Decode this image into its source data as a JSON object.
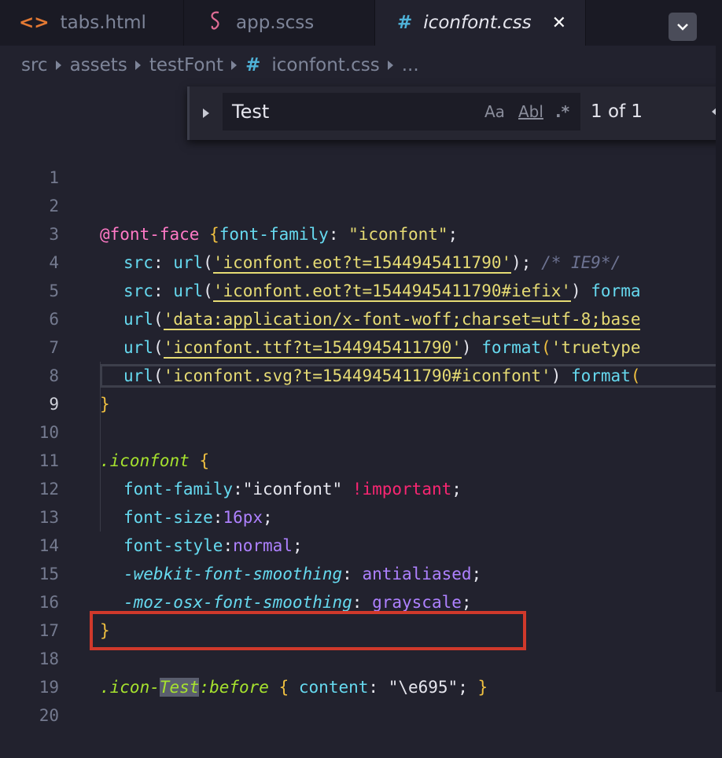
{
  "tabs": [
    {
      "icon": "<>",
      "label": "tabs.html"
    },
    {
      "icon": "sass",
      "label": "app.scss"
    },
    {
      "icon": "#",
      "label": "iconfont.css",
      "active": true
    }
  ],
  "breadcrumb": [
    "src",
    "assets",
    "testFont",
    "iconfont.css",
    "..."
  ],
  "find": {
    "query": "Test",
    "match_case": "Aa",
    "whole_word": "Abl",
    "regex": ".*",
    "count": "1 of 1"
  },
  "lines": [
    "1",
    "2",
    "3",
    "4",
    "5",
    "6",
    "7",
    "8",
    "9",
    "10",
    "11",
    "12",
    "13",
    "14",
    "15",
    "16",
    "17",
    "18",
    "19",
    "20"
  ],
  "code": {
    "l2": [
      "@font-face",
      " {",
      "font-family",
      ": ",
      "\"iconfont\"",
      ";"
    ],
    "l3": [
      "src",
      ": ",
      "url",
      "(",
      "'iconfont.eot?t=1544945411790'",
      ");",
      " /* IE9*/"
    ],
    "l4": [
      "src",
      ": ",
      "url",
      "(",
      "'iconfont.eot?t=1544945411790#iefix'",
      ") ",
      "forma"
    ],
    "l5": [
      "url",
      "(",
      "'data:application/x-font-woff;charset=utf-8;base"
    ],
    "l6": [
      "url",
      "(",
      "'iconfont.ttf?t=1544945411790'",
      ") ",
      "format",
      "(",
      "'truetype"
    ],
    "l7": [
      "url",
      "(",
      "'iconfont.svg?t=1544945411790#iconfont'",
      ") ",
      "format",
      "("
    ],
    "l8": [
      "}"
    ],
    "l10": [
      ".iconfont",
      " {"
    ],
    "l11": [
      "font-family",
      ":",
      "\"iconfont\"",
      " !important",
      ";"
    ],
    "l12": [
      "font-size",
      ":",
      "16px",
      ";"
    ],
    "l13": [
      "font-style",
      ":",
      "normal",
      ";"
    ],
    "l14": [
      "-webkit-font-smoothing",
      ": ",
      "antialiased",
      ";"
    ],
    "l15": [
      "-moz-osx-font-smoothing",
      ": ",
      "grayscale",
      ";"
    ],
    "l16": [
      "}"
    ],
    "l18": [
      ".icon-",
      "Test",
      ":before",
      " { ",
      "content",
      ": ",
      "\"\\e695\"",
      ";",
      " }"
    ]
  },
  "colors": {
    "highlight_border": "#d0392b",
    "background": "#22222e"
  }
}
